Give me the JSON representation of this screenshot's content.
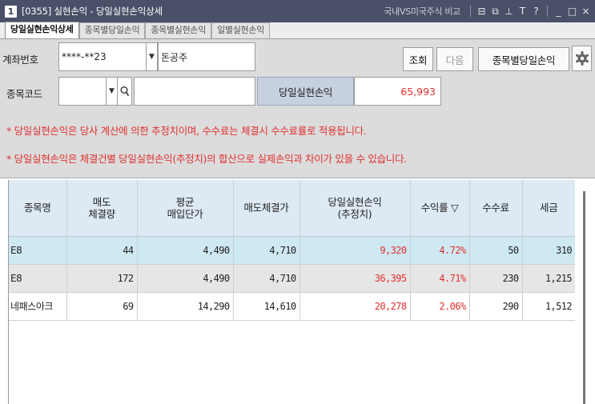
{
  "window": {
    "number": "1",
    "title": "[0355] 실현손익 - 당일실현손익상세",
    "compare_label": "국내VS미국주식 비교",
    "title_icons": [
      "link-icon",
      "copy-icon",
      "pin-icon",
      "font-icon",
      "help-icon",
      "minimize-icon",
      "maximize-icon",
      "close-icon"
    ],
    "title_glyphs": [
      "⊟",
      "⧉",
      "⊥",
      "T",
      "?",
      "_",
      "□",
      "×"
    ]
  },
  "tabs": [
    {
      "label": "당일실현손익상세",
      "active": true
    },
    {
      "label": "종목별당일손익",
      "active": false
    },
    {
      "label": "종목별실현손익",
      "active": false
    },
    {
      "label": "일별실현손익",
      "active": false
    }
  ],
  "form": {
    "account_label": "계좌번호",
    "account_value": "****-**23",
    "account_holder": "돈공주",
    "query_button": "조회",
    "next_button": "다음",
    "by_stock_button": "종목별당일손익",
    "stock_code_label": "종목코드",
    "stock_code_value": "",
    "stock_name_value": "",
    "realized_label": "당일실현손익",
    "realized_value": "65,993"
  },
  "notices": [
    "* 당일실현손익은 당사 계산에 의한 추정치이며, 수수료는 체결시 수수료률로 적용됩니다.",
    "* 당일실현손익은 체결건별 당일실현손익(추정치)의 합산으로 실제손익과 차이가 있을 수 있습니다."
  ],
  "table": {
    "headers": [
      "종목명",
      "매도\n체결량",
      "평균\n매입단가",
      "매도체결가",
      "당일실현손익\n(추정치)",
      "수익률 ▽",
      "수수료",
      "세금"
    ],
    "rows": [
      [
        "E8",
        "44",
        "4,490",
        "4,710",
        "9,320",
        "4.72%",
        "50",
        "310"
      ],
      [
        "E8",
        "172",
        "4,490",
        "4,710",
        "36,395",
        "4.71%",
        "230",
        "1,215"
      ],
      [
        "네패스아크",
        "69",
        "14,290",
        "14,610",
        "20,278",
        "2.06%",
        "290",
        "1,512"
      ]
    ]
  },
  "colors": {
    "title_bar": "#4a5068",
    "profit_red": "#e03030",
    "header_blue": "#dde9f3",
    "row_selected": "#cfe9f2",
    "row_alt": "#e6e6e6"
  }
}
